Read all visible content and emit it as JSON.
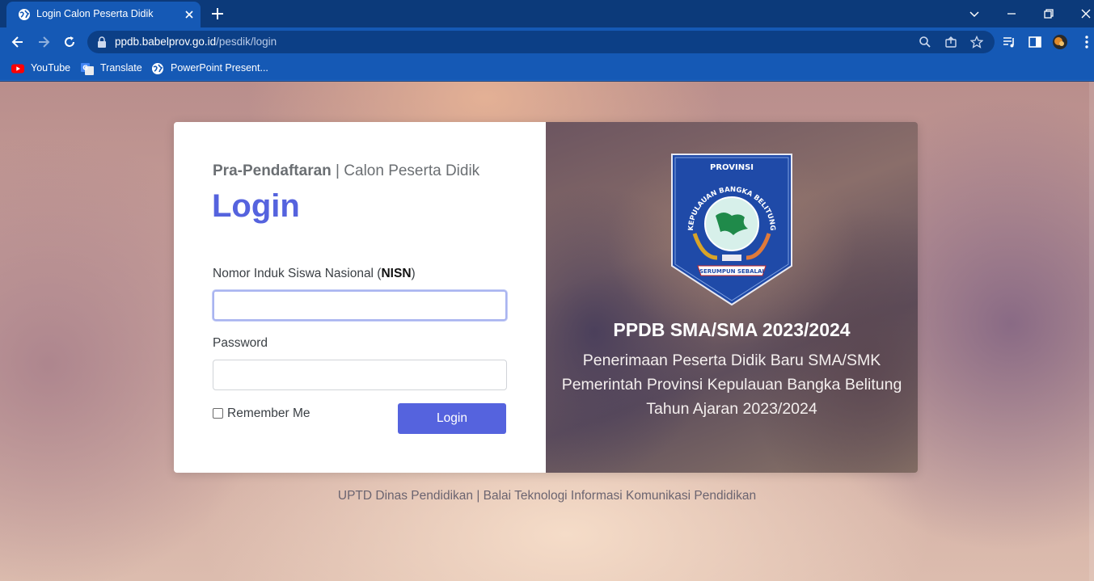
{
  "browser": {
    "tab_title": "Login Calon Peserta Didik",
    "url_host": "ppdb.babelprov.go.id",
    "url_path": "/pesdik/login",
    "bookmarks": [
      {
        "label": "YouTube",
        "icon": "youtube-icon"
      },
      {
        "label": "Translate",
        "icon": "translate-icon"
      },
      {
        "label": "PowerPoint Present...",
        "icon": "globe-icon"
      }
    ]
  },
  "login": {
    "subtitle_bold": "Pra-Pendaftaran",
    "subtitle_rest": " | Calon Peserta Didik",
    "heading": "Login",
    "nisn_label_pre": "Nomor Induk Siswa Nasional (",
    "nisn_label_bold": "NISN",
    "nisn_label_post": ")",
    "nisn_value": "",
    "password_label": "Password",
    "password_value": "",
    "remember_label": "Remember Me",
    "remember_checked": false,
    "submit_label": "Login"
  },
  "banner": {
    "logo_top_text": "PROVINSI",
    "logo_arc_text": "KEPULAUAN BANGKA BELITUNG",
    "logo_ribbon_text": "SERUMPUN SEBALAI",
    "title": "PPDB SMA/SMA 2023/2024",
    "line1": "Penerimaan Peserta Didik Baru SMA/SMK",
    "line2": "Pemerintah Provinsi Kepulauan Bangka Belitung",
    "line3": "Tahun Ajaran 2023/2024"
  },
  "footer": "UPTD Dinas Pendidikan | Balai Teknologi Informasi Komunikasi Pendidikan",
  "colors": {
    "accent": "#5563de",
    "chrome": "#1559b5",
    "chrome_dark": "#0c3a7a"
  }
}
